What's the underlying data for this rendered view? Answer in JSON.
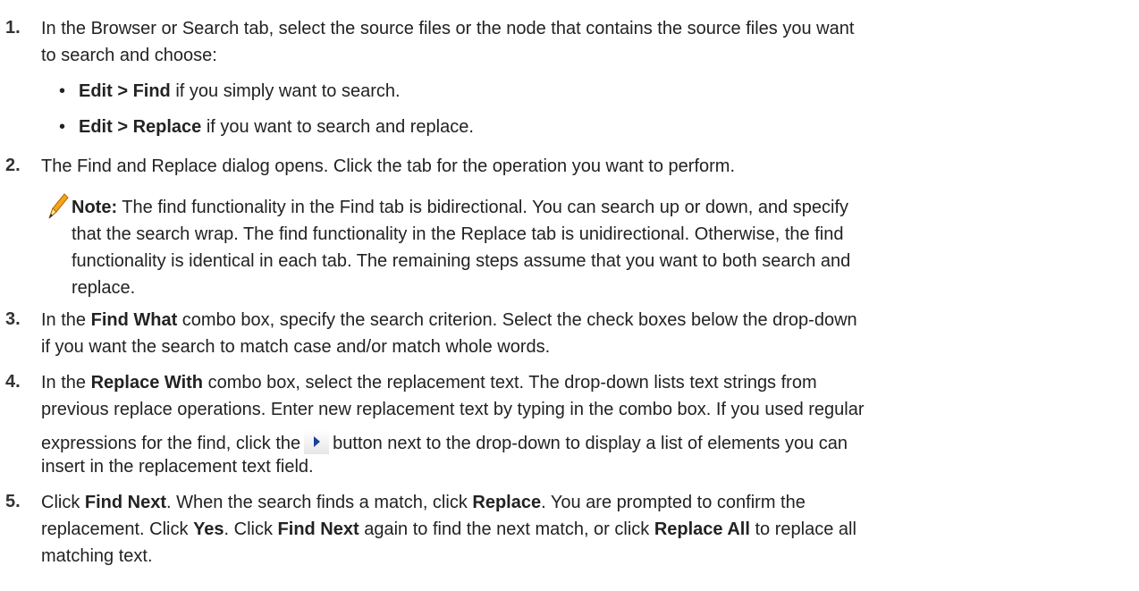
{
  "steps": [
    {
      "num": "1.",
      "l1": "In the Browser or Search tab, select the source files or the node that contains the source files you want",
      "l2": "to search and choose:",
      "bullets": [
        {
          "bold": "Edit > Find",
          "rest": " if you simply want to search."
        },
        {
          "bold": "Edit > Replace",
          "rest": " if you want to search and replace."
        }
      ]
    },
    {
      "num": "2.",
      "l1": "The Find and Replace dialog opens. Click the tab for the operation you want to perform.",
      "note": {
        "icon": "pencil-icon",
        "label": "Note:",
        "l1": " The find functionality in the Find tab is bidirectional. You can search up or down, and specify",
        "l2": "that the search wrap. The find functionality in the Replace tab is unidirectional. Otherwise, the find",
        "l3": "functionality is identical in each tab. The remaining steps assume that you want to both search and",
        "l4": "replace."
      }
    },
    {
      "num": "3.",
      "a": "In the ",
      "b": "Find What",
      "c": " combo box, specify the search criterion. Select the check boxes below the drop-down",
      "l2": "if you want the search to match case and/or match whole words."
    },
    {
      "num": "4.",
      "a": "In the ",
      "b": "Replace With",
      "c": " combo box, select the replacement text. The drop-down lists text strings from",
      "l2": "previous replace operations. Enter new replacement text by typing in the combo box. If you used regular",
      "l3a": "expressions for the find, click the",
      "l3b": "button next to the drop-down to display a list of elements you can",
      "l4": "insert in the replacement text field.",
      "button_icon": "play-arrow-icon"
    },
    {
      "num": "5.",
      "l1a": "Click ",
      "l1b": "Find Next",
      "l1c": ". When the search finds a match, click ",
      "l1d": "Replace",
      "l1e": ". You are prompted to confirm the",
      "l2a": "replacement. Click ",
      "l2b": "Yes",
      "l2c": ". Click ",
      "l2d": "Find Next",
      "l2e": " again to find the next match, or click ",
      "l2f": "Replace All",
      "l2g": " to replace all",
      "l3": "matching text."
    }
  ]
}
